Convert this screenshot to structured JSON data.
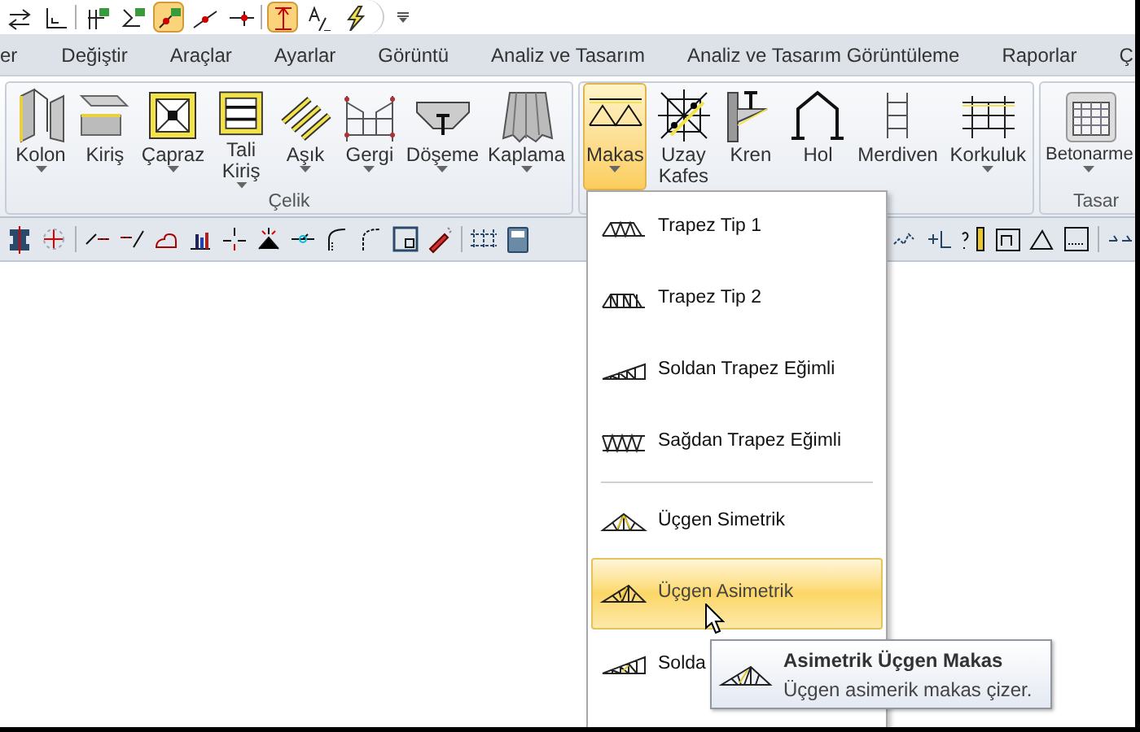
{
  "quick_toolbar": {
    "buttons": [
      {
        "selected": false
      },
      {
        "selected": false
      },
      {
        "selected": false
      },
      {
        "selected": false
      },
      {
        "selected": true
      },
      {
        "selected": false
      },
      {
        "selected": false
      },
      {
        "selected": true
      },
      {
        "selected": false
      },
      {
        "selected": false
      }
    ]
  },
  "tabs": [
    {
      "label": "er",
      "selected": false
    },
    {
      "label": "Değiştir",
      "selected": false
    },
    {
      "label": "Araçlar",
      "selected": false
    },
    {
      "label": "Ayarlar",
      "selected": false
    },
    {
      "label": "Görüntü",
      "selected": false
    },
    {
      "label": "Analiz ve Tasarım",
      "selected": false
    },
    {
      "label": "Analiz ve Tasarım Görüntüleme",
      "selected": false
    },
    {
      "label": "Raporlar",
      "selected": false
    },
    {
      "label": "Ç",
      "selected": false
    }
  ],
  "ribbon": {
    "groups": [
      {
        "label": "Çelik",
        "buttons": [
          {
            "label": "Kolon",
            "dropdown": true,
            "selected": false
          },
          {
            "label": "Kiriş",
            "dropdown": false,
            "selected": false
          },
          {
            "label": "Çapraz",
            "dropdown": true,
            "selected": false
          },
          {
            "label": "Tali Kiriş",
            "dropdown": true,
            "selected": false
          },
          {
            "label": "Aşık",
            "dropdown": true,
            "selected": false
          },
          {
            "label": "Gergi",
            "dropdown": true,
            "selected": false
          },
          {
            "label": "Döşeme",
            "dropdown": true,
            "selected": false
          },
          {
            "label": "Kaplama",
            "dropdown": true,
            "selected": false
          }
        ]
      },
      {
        "buttons": [
          {
            "label": "Makas",
            "dropdown": true,
            "selected": true
          },
          {
            "label": "Uzay Kafes",
            "dropdown": false,
            "selected": false
          },
          {
            "label": "Kren",
            "dropdown": false,
            "selected": false
          },
          {
            "label": "Hol",
            "dropdown": false,
            "selected": false
          },
          {
            "label": "Merdiven",
            "dropdown": false,
            "selected": false
          },
          {
            "label": "Korkuluk",
            "dropdown": true,
            "selected": false
          }
        ]
      },
      {
        "label": "Tasar",
        "buttons": [
          {
            "label": "Betonarme",
            "dropdown": true,
            "selected": false
          }
        ]
      }
    ]
  },
  "menu": {
    "items": [
      {
        "kind": "item",
        "label": "Trapez Tip 1",
        "selected": false
      },
      {
        "kind": "item",
        "label": "Trapez Tip 2",
        "selected": false
      },
      {
        "kind": "item",
        "label": "Soldan Trapez Eğimli",
        "selected": false
      },
      {
        "kind": "item",
        "label": "Sağdan Trapez Eğimli",
        "selected": false
      },
      {
        "kind": "separator"
      },
      {
        "kind": "item",
        "label": "Üçgen Simetrik",
        "selected": false
      },
      {
        "kind": "item",
        "label": "Üçgen Asimetrik",
        "selected": true
      },
      {
        "kind": "item",
        "label": "Solda",
        "selected": false
      }
    ]
  },
  "tooltip": {
    "title": "Asimetrik Üçgen Makas",
    "description": "Üçgen asimerik makas çizer."
  }
}
